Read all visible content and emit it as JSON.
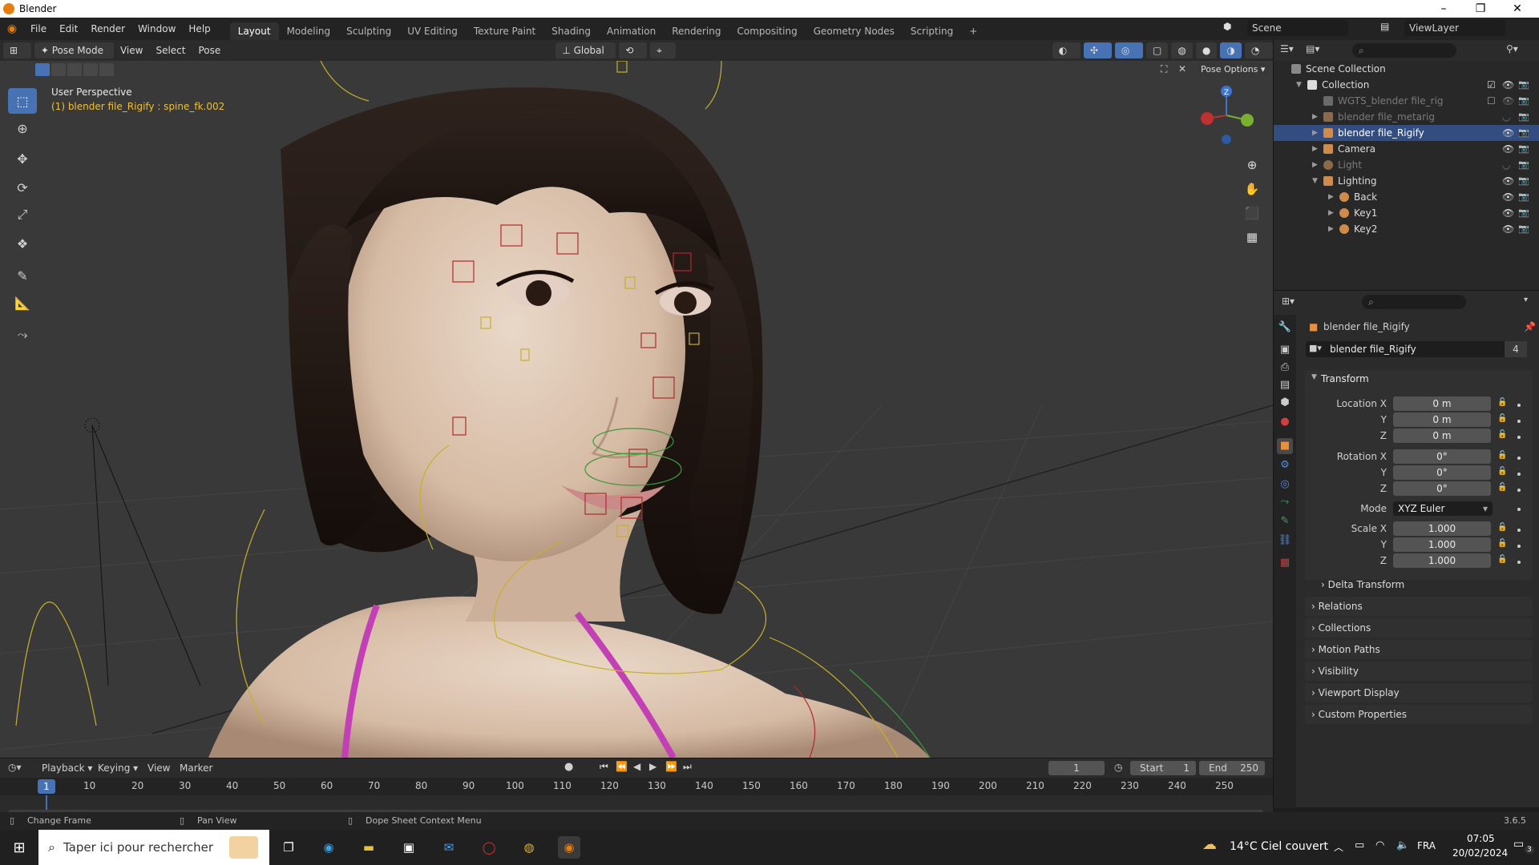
{
  "window": {
    "title": "Blender",
    "min": "–",
    "max": "❐",
    "close": "✕"
  },
  "menu": [
    "File",
    "Edit",
    "Render",
    "Window",
    "Help"
  ],
  "workspaces": [
    "Layout",
    "Modeling",
    "Sculpting",
    "UV Editing",
    "Texture Paint",
    "Shading",
    "Animation",
    "Rendering",
    "Compositing",
    "Geometry Nodes",
    "Scripting"
  ],
  "workspace_add": "+",
  "scene": {
    "name": "Scene",
    "view_layer": "ViewLayer"
  },
  "viewport_header": {
    "mode": "Pose Mode",
    "view": "View",
    "select": "Select",
    "pose": "Pose",
    "orientation": "Global",
    "pose_options": "Pose Options"
  },
  "viewport": {
    "perspective": "User Perspective",
    "active": "(1) blender file_Rigify : spine_fk.002",
    "gizmo": {
      "z": "Z"
    }
  },
  "outliner": {
    "rows": [
      {
        "label": "Scene Collection",
        "indent": 0
      },
      {
        "label": "Collection",
        "indent": 1
      },
      {
        "label": "WGTS_blender file_rig",
        "indent": 2
      },
      {
        "label": "blender file_metarig",
        "indent": 2
      },
      {
        "label": "blender file_Rigify",
        "indent": 2
      },
      {
        "label": "Camera",
        "indent": 2
      },
      {
        "label": "Light",
        "indent": 2
      },
      {
        "label": "Lighting",
        "indent": 2
      },
      {
        "label": "Back",
        "indent": 3
      },
      {
        "label": "Key1",
        "indent": 3
      },
      {
        "label": "Key2",
        "indent": 3
      }
    ]
  },
  "properties": {
    "object_name": "blender file_Rigify",
    "datablock_name": "blender file_Rigify",
    "users": "4",
    "transform": {
      "header": "Transform",
      "location_label": "Location X",
      "y_label": "Y",
      "z_label": "Z",
      "location": [
        "0 m",
        "0 m",
        "0 m"
      ],
      "rotation_label": "Rotation X",
      "rotation": [
        "0°",
        "0°",
        "0°"
      ],
      "mode_label": "Mode",
      "mode": "XYZ Euler",
      "scale_label": "Scale X",
      "scale": [
        "1.000",
        "1.000",
        "1.000"
      ]
    },
    "panels": [
      "Delta Transform",
      "Relations",
      "Collections",
      "Motion Paths",
      "Visibility",
      "Viewport Display",
      "Custom Properties"
    ]
  },
  "timeline": {
    "menus": [
      "Playback",
      "Keying",
      "View",
      "Marker"
    ],
    "current_frame": "1",
    "start_label": "Start",
    "start": "1",
    "end_label": "End",
    "end": "250",
    "ticks": [
      "1",
      "10",
      "20",
      "30",
      "40",
      "50",
      "60",
      "70",
      "80",
      "90",
      "100",
      "110",
      "120",
      "130",
      "140",
      "150",
      "160",
      "170",
      "180",
      "190",
      "200",
      "210",
      "220",
      "230",
      "240",
      "250"
    ]
  },
  "statusbar": {
    "left": "Change Frame",
    "middle": "Pan View",
    "right": "Dope Sheet Context Menu",
    "version": "3.6.5"
  },
  "taskbar": {
    "search_placeholder": "Taper ici pour rechercher",
    "weather": "14°C  Ciel couvert",
    "language": "FRA",
    "time": "07:05",
    "date": "20/02/2024",
    "notifications": "3"
  },
  "colors": {
    "accent": "#4772b3",
    "selected_row": "#334d80",
    "blender_orange": "#e87d0d"
  }
}
